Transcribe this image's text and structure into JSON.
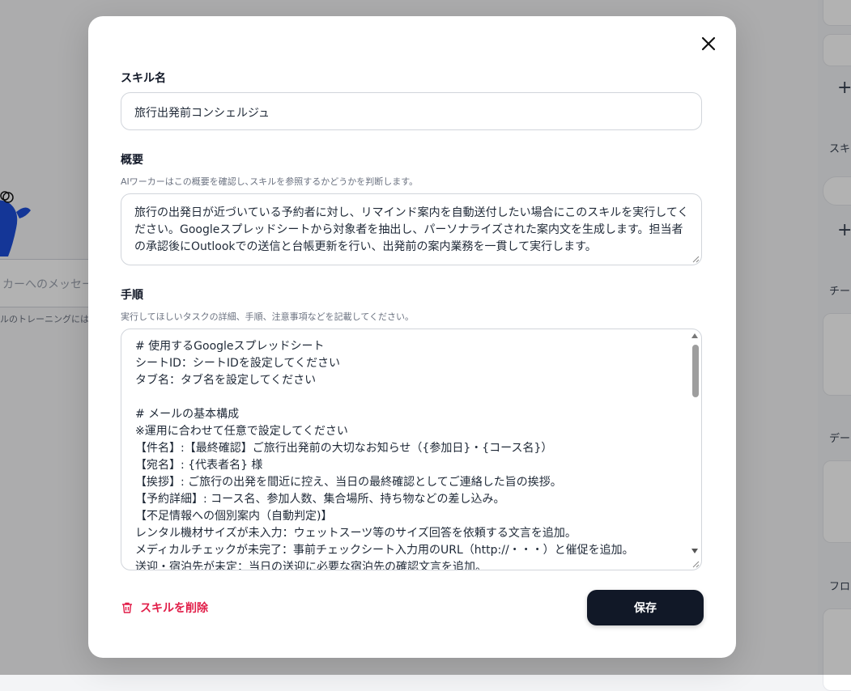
{
  "background": {
    "chat_placeholder": "カーへのメッセー",
    "training_note": "ルのトレーニングには",
    "right_panel_labels": [
      "スキ",
      "チー",
      "デー",
      "フロ"
    ],
    "plus": "+"
  },
  "modal": {
    "close_icon": "close-icon",
    "skill_name": {
      "label": "スキル名",
      "value": "旅行出発前コンシェルジュ"
    },
    "summary": {
      "label": "概要",
      "hint": "AIワーカーはこの概要を確認し､スキルを参照するかどうかを判断します。",
      "value": "旅行の出発日が近づいている予約者に対し、リマインド案内を自動送付したい場合にこのスキルを実行してください。Googleスプレッドシートから対象者を抽出し、パーソナライズされた案内文を生成します。担当者の承認後にOutlookでの送信と台帳更新を行い、出発前の案内業務を一貫して実行します。"
    },
    "steps": {
      "label": "手順",
      "hint": "実行してほしいタスクの詳細、手順、注意事項などを記載してください。",
      "lines": [
        "# 使用するGoogleスプレッドシート",
        "シートID：シートIDを設定してください",
        "タブ名：タブ名を設定してください",
        "",
        "# メールの基本構成",
        "※運用に合わせて任意で設定してください",
        "【件名】:【最終確認】ご旅行出発前の大切なお知らせ（{参加日}・{コース名}）",
        "【宛名】: {代表者名} 様",
        "【挨拶】: ご旅行の出発を間近に控え、当日の最終確認としてご連絡した旨の挨拶。",
        "【予約詳細】: コース名、参加人数、集合場所、持ち物などの差し込み。",
        "【不足情報への個別案内（自動判定)】",
        "レンタル機材サイズが未入力：ウェットスーツ等のサイズ回答を依頼する文言を追加。",
        "メディカルチェックが未完了：事前チェックシート入力用のURL（http://・・・）と催促を追加。",
        "送迎・宿泊先が未定：当日の送迎に必要な宿泊先の確認文言を追加。"
      ]
    },
    "delete_label": "スキルを削除",
    "save_label": "保存"
  },
  "colors": {
    "danger": "#e11d48",
    "primary": "#111827",
    "mascot": "#1d4ed8"
  }
}
